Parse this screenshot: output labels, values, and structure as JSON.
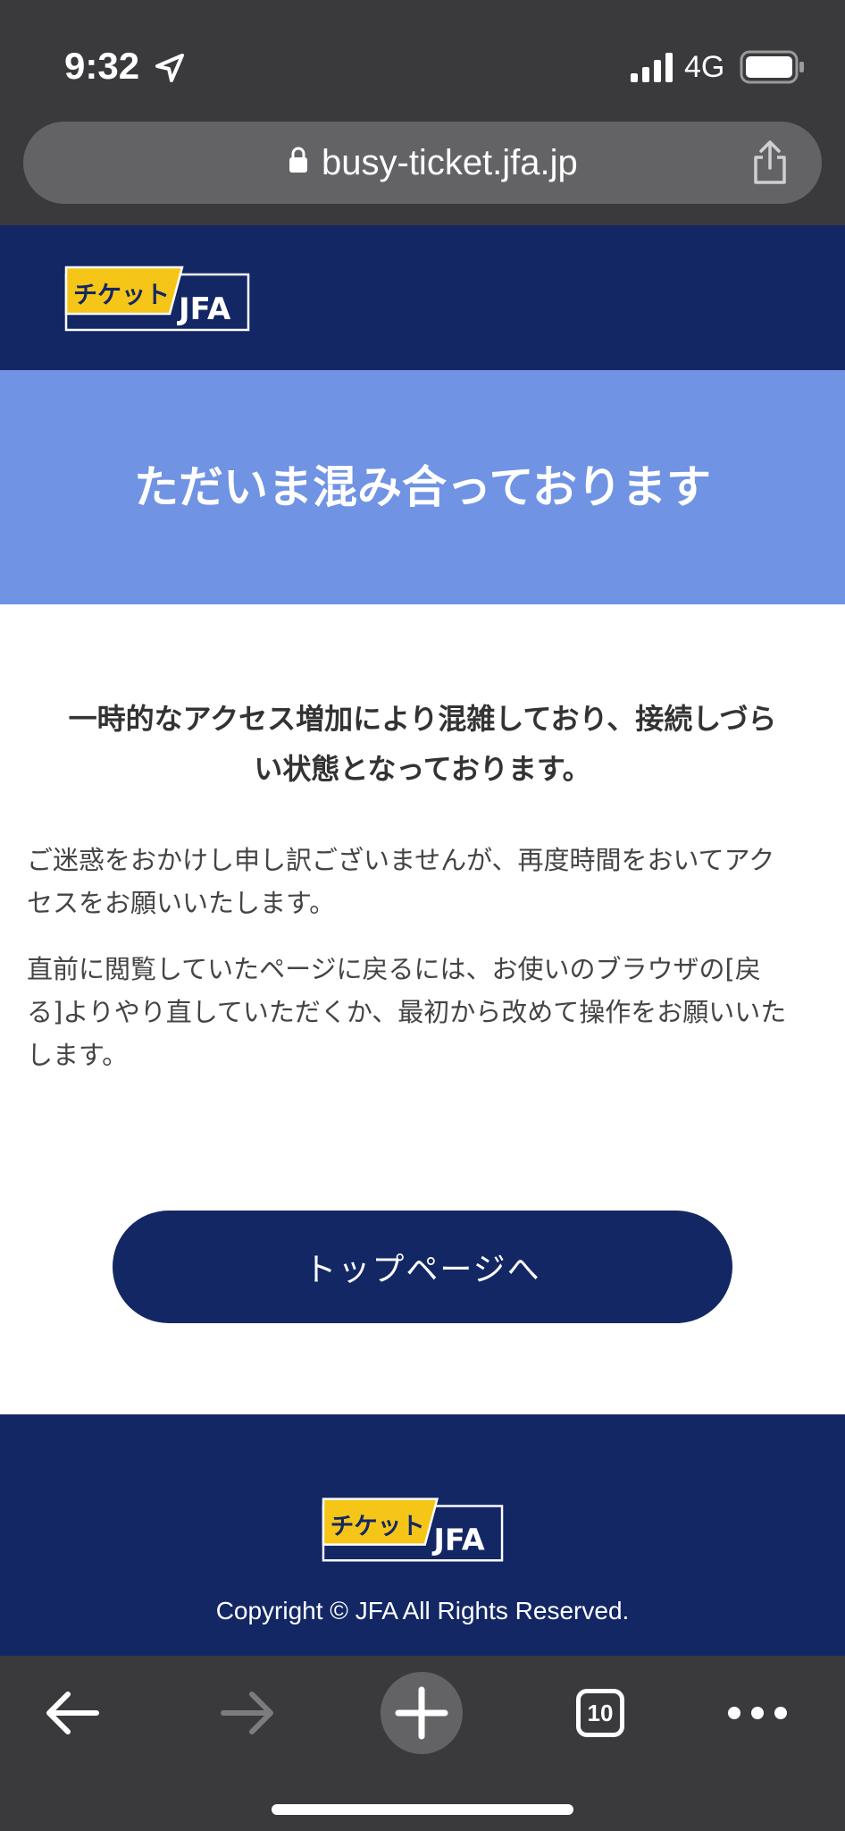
{
  "status_bar": {
    "time": "9:32",
    "network": "4G"
  },
  "browser": {
    "url": "busy-ticket.jfa.jp",
    "tab_count": "10"
  },
  "header": {
    "logo_text_ja": "チケット",
    "logo_text_en": "JFA"
  },
  "hero": {
    "title": "ただいま混み合っております"
  },
  "main": {
    "lead_line1": "一時的なアクセス増加により混雑しており、接続しづら",
    "lead_line2": "い状態となっております。",
    "para1_line1": "ご迷惑をおかけし申し訳ございませんが、再度時間をおいてアク",
    "para1_line2": "セスをお願いいたします。",
    "para2_line1": "直前に閲覧していたページに戻るには、お使いのブラウザの[戻",
    "para2_line2": "る]よりやり直していただくか、最初から改めて操作をお願いいた",
    "para2_line3": "します。",
    "top_button_label": "トップページへ"
  },
  "footer": {
    "logo_text_ja": "チケット",
    "logo_text_en": "JFA",
    "copyright": "Copyright © JFA All Rights Reserved."
  },
  "colors": {
    "navy": "#132765",
    "hero_blue": "#7093e3",
    "logo_yellow": "#f5c518",
    "chrome_dark": "#3a3a3c"
  }
}
